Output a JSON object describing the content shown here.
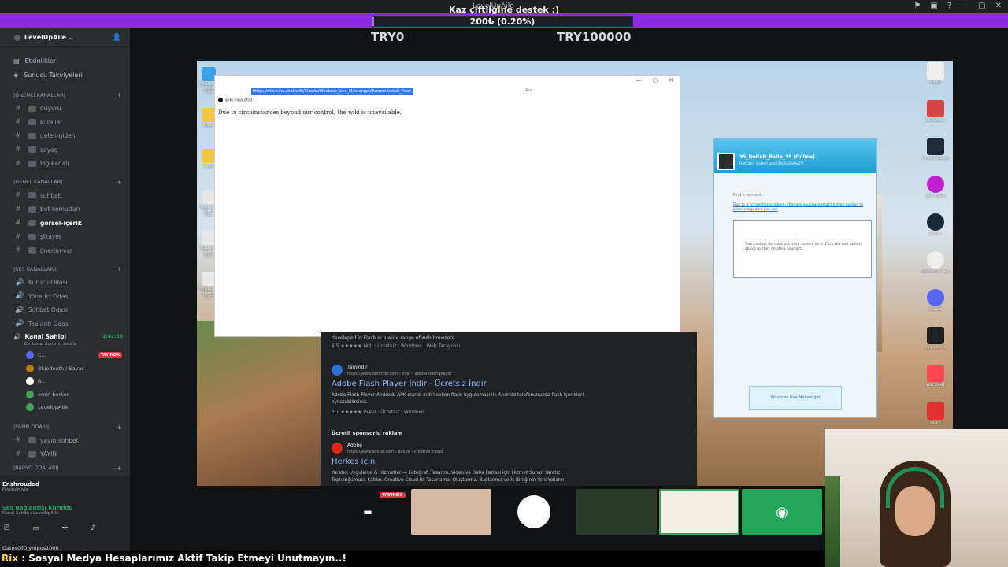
{
  "titlebar": {
    "title": "LevelUpAile"
  },
  "donation": {
    "caption": "Kaz çiftliğine destek :)",
    "progress_text": "200₺ (0.20%)",
    "progress_fraction": 0.002,
    "goal_min": "TRY0",
    "goal_max": "TRY100000"
  },
  "sidebar": {
    "server_name": "LevelUpAile",
    "top_items": [
      "Etkinlikler",
      "Sunucu Takviyeleri"
    ],
    "categories": [
      {
        "label": "|ÖNEMLİ KANALLAR|",
        "channels": [
          "duyuru",
          "kurallar",
          "gelen-giden",
          "sayaç",
          "log-kanalı"
        ]
      },
      {
        "label": "|GENEL KANALLAR|",
        "channels": [
          "sohbet",
          "bot-komutları",
          "görsel-içerik",
          "şikayet",
          "önerim-var"
        ]
      },
      {
        "label": "|SES KANALLARI|",
        "channels": [
          "Kurucu Odası",
          "Yönetici Odası",
          "Sohbet Odası",
          "Toplantı Odası"
        ]
      }
    ],
    "active_voice": {
      "name": "Kanal Sahibi",
      "time": "2:42:33",
      "sub": "Bir kanal durumu belirle",
      "users": [
        "C...",
        "Bluedeath / Savaş",
        "B...",
        "emin berker",
        "LevelUpAile"
      ],
      "live_label": "YAYINDA"
    },
    "yayin": {
      "label": "|YAYIN ODASI|",
      "channels": [
        "yayın-sohbet",
        "YAYIN"
      ]
    },
    "radio": {
      "label": "|RADYO ODALARI|"
    },
    "bottom": {
      "game": "Enshrouded",
      "game_sub": "Paylaşılmıyor",
      "connection": "Ses Bağlantısı Kuruldu",
      "connection_sub": "Kanal Sahibi / LevelUpAile",
      "user": "GatesOfOlympus1000"
    }
  },
  "browser": {
    "url": "https://wiki.nina.chat/wiki/Clients/Windows_Live_Messenger/Tutorial:Install_Flash",
    "tab": "wiki.nina.chat",
    "search_placeholder": "Ara...",
    "message": "Due to circumstances beyond our control, the wiki is unavailable."
  },
  "results": {
    "line1": "developed in Flash in a wide range of web browsers.",
    "meta1": "4,5 ★★★★★ (40) · Ücretsiz · Windows · Web Tarayıcısı",
    "site": "Tamindir",
    "site_url": "https://www.tamindir.com › indir › adobe-flash-player",
    "title": "Adobe Flash Player İndir - Ücretsiz İndir",
    "desc": "Adobe Flash Player Android: APK olarak indirilebilen flash uygulaması ile Android telefonunuzda flash içerikleri oynatabilirsiniz.",
    "rating": "3,1 ★★★★★ (540) · Ücretsiz · Windows",
    "sponsor": "Ücretli sponsorlu reklam",
    "site2": "Adobe",
    "site2_url": "https://www.adobe.com › adobe › creative_cloud",
    "title2": "Herkes için",
    "desc2": "Yaratıcı Uygulama & Hizmetler — Fotoğraf, Tasarım, Video ve Daha Fazlası için Hizmet Sunan Yaratıcı Topluluğumuza Katılın. Creative Cloud ile Tasarlama, Oluşturma, Bağlanma ve İş Birliğinin Yeni Yollarını"
  },
  "messenger": {
    "name": "35_DoGaN_Balta_35",
    "status": "(Online)",
    "sub": "DeKoDe! KaDeR aLaYiNa GiDeMeZ!!",
    "find": "Find a contact...",
    "warning": "Due to a connection problem, changes you make might not be applied to other computers you use",
    "empty": "Your contact list does not have anyone on it. Click the Add button above to start creating your list.",
    "brand": "Windows Live Messenger"
  },
  "desktop_icons_left": [
    "WhatsApp Görsel 2025",
    "Bugün",
    "Hayat",
    "WhatsApp Görsel 2025",
    "WhatsApp Görsel 2025",
    "WhatsApp Görsel 2025"
  ],
  "desktop_icons_right": [
    "NIKKE",
    "BlueStacks",
    "Amazon Games",
    "OBS Studio",
    "Steam",
    "Ubisoft Connect",
    "Discord",
    "Epic Games",
    "VALORANT",
    "Faceit"
  ],
  "cams": {
    "live_label": "YAYINDA"
  },
  "ticker": {
    "nick": "Rix",
    "text": " : Sosyal Medya Hesaplarımız Aktif Takip Etmeyi Unutmayın..!"
  },
  "colors": {
    "donation_bar": "#8a2be2",
    "discord_bg": "#2b2d31",
    "live": "#da373c",
    "link": "#8ab4f8"
  }
}
